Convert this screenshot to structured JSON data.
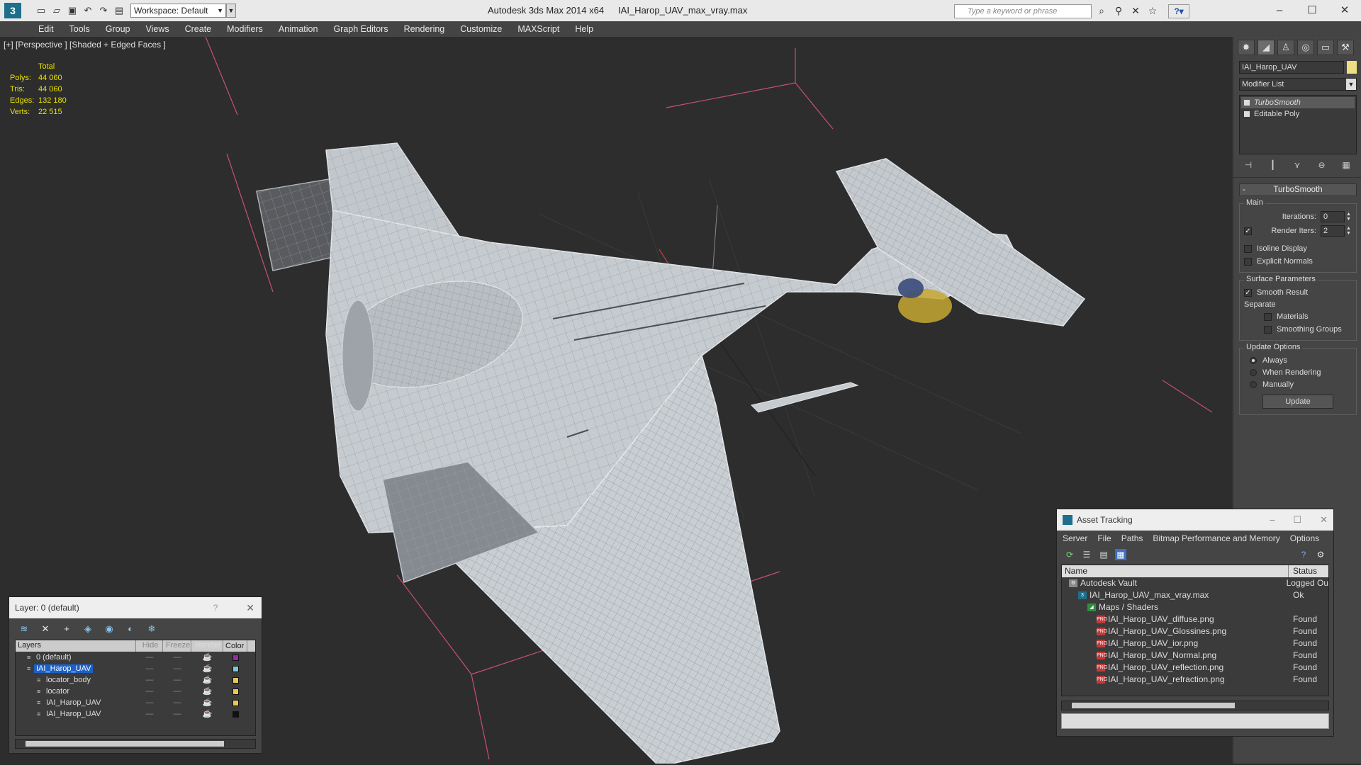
{
  "titlebar": {
    "app_name": "Autodesk 3ds Max  2014 x64",
    "file_name": "IAI_Harop_UAV_max_vray.max",
    "workspace": "Workspace: Default",
    "search_placeholder": "Type a keyword or phrase",
    "logo_text": "3"
  },
  "menu": [
    "Edit",
    "Tools",
    "Group",
    "Views",
    "Create",
    "Modifiers",
    "Animation",
    "Graph Editors",
    "Rendering",
    "Customize",
    "MAXScript",
    "Help"
  ],
  "viewport": {
    "label": "[+] [Perspective ] [Shaded + Edged Faces ]",
    "stats": {
      "header": "Total",
      "rows": [
        {
          "k": "Polys:",
          "v": "44 060"
        },
        {
          "k": "Tris:",
          "v": "44 060"
        },
        {
          "k": "Edges:",
          "v": "132 180"
        },
        {
          "k": "Verts:",
          "v": "22 515"
        }
      ]
    }
  },
  "command_panel": {
    "object_name": "IAI_Harop_UAV",
    "modifier_list": "Modifier List",
    "stack": [
      {
        "label": "TurboSmooth",
        "selected": true
      },
      {
        "label": "Editable Poly",
        "selected": false
      }
    ],
    "rollout_title": "TurboSmooth",
    "main_group": "Main",
    "iterations_label": "Iterations:",
    "iterations_value": "0",
    "render_iters_label": "Render Iters:",
    "render_iters_value": "2",
    "isoline_display": "Isoline Display",
    "explicit_normals": "Explicit Normals",
    "surface_params": "Surface Parameters",
    "smooth_result": "Smooth Result",
    "separate": "Separate",
    "materials": "Materials",
    "smoothing_groups": "Smoothing Groups",
    "update_options": "Update Options",
    "always": "Always",
    "when_rendering": "When Rendering",
    "manually": "Manually",
    "update_button": "Update"
  },
  "layer_window": {
    "title": "Layer: 0 (default)",
    "help": "?",
    "columns": [
      "Layers",
      "Hide",
      "Freeze",
      "Render",
      "Color"
    ],
    "rows": [
      {
        "name": "0 (default)",
        "indent": 1,
        "color": "#9b27a8",
        "selected": false
      },
      {
        "name": "IAI_Harop_UAV",
        "indent": 1,
        "color": "#7fc6d6",
        "selected": true
      },
      {
        "name": "locator_body",
        "indent": 2,
        "color": "#e8c850",
        "selected": false
      },
      {
        "name": "locator",
        "indent": 2,
        "color": "#e8c850",
        "selected": false
      },
      {
        "name": "IAI_Harop_UAV",
        "indent": 2,
        "color": "#e8c850",
        "selected": false
      },
      {
        "name": "IAI_Harop_UAV",
        "indent": 2,
        "color": "#111111",
        "selected": false
      }
    ]
  },
  "asset_window": {
    "title": "Asset Tracking",
    "menu": [
      "Server",
      "File",
      "Paths",
      "Bitmap Performance and Memory",
      "Options"
    ],
    "columns": [
      "Name",
      "Status"
    ],
    "rows": [
      {
        "name": "Autodesk Vault",
        "status": "Logged Ou",
        "indent": 1,
        "icon": "vault"
      },
      {
        "name": "IAI_Harop_UAV_max_vray.max",
        "status": "Ok",
        "indent": 2,
        "icon": "max"
      },
      {
        "name": "Maps / Shaders",
        "status": "",
        "indent": 3,
        "icon": "maps"
      },
      {
        "name": "IAI_Harop_UAV_diffuse.png",
        "status": "Found",
        "indent": 4,
        "icon": "png"
      },
      {
        "name": "IAI_Harop_UAV_Glossines.png",
        "status": "Found",
        "indent": 4,
        "icon": "png"
      },
      {
        "name": "IAI_Harop_UAV_ior.png",
        "status": "Found",
        "indent": 4,
        "icon": "png"
      },
      {
        "name": "IAI_Harop_UAV_Normal.png",
        "status": "Found",
        "indent": 4,
        "icon": "png"
      },
      {
        "name": "IAI_Harop_UAV_reflection.png",
        "status": "Found",
        "indent": 4,
        "icon": "png"
      },
      {
        "name": "IAI_Harop_UAV_refraction.png",
        "status": "Found",
        "indent": 4,
        "icon": "png"
      }
    ]
  },
  "colors": {
    "accent_selected": "#1b61c8",
    "stats_text": "#e8e200",
    "viewport_bg": "#2d2d2d"
  }
}
